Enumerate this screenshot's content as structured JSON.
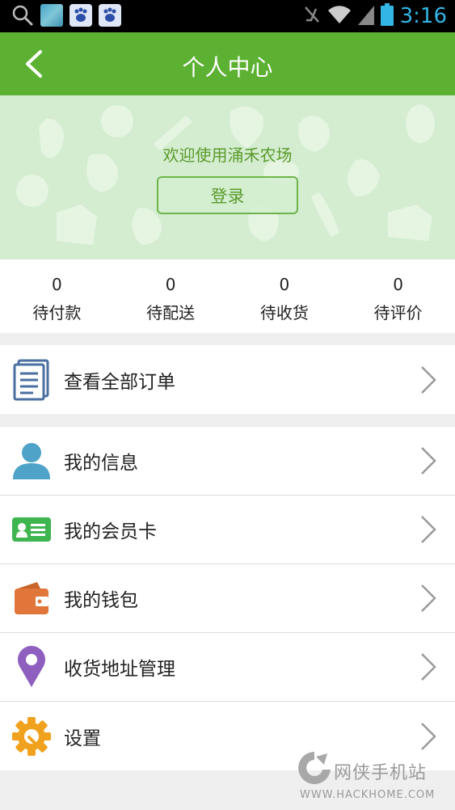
{
  "status_bar": {
    "time": "3:16"
  },
  "header": {
    "title": "个人中心"
  },
  "banner": {
    "welcome": "欢迎使用涌禾农场",
    "login_label": "登录"
  },
  "order_stats": [
    {
      "count": "0",
      "label": "待付款"
    },
    {
      "count": "0",
      "label": "待配送"
    },
    {
      "count": "0",
      "label": "待收货"
    },
    {
      "count": "0",
      "label": "待评价"
    }
  ],
  "menu": {
    "orders": {
      "label": "查看全部订单",
      "icon": "document-icon"
    },
    "items": [
      {
        "label": "我的信息",
        "icon": "user-icon"
      },
      {
        "label": "我的会员卡",
        "icon": "member-card-icon"
      },
      {
        "label": "我的钱包",
        "icon": "wallet-icon"
      },
      {
        "label": "收货地址管理",
        "icon": "location-pin-icon"
      },
      {
        "label": "设置",
        "icon": "gear-icon"
      }
    ]
  },
  "watermark": {
    "title": "网侠手机站",
    "url": "WWW.HACKHOME.COM"
  },
  "colors": {
    "primary_green": "#5cb133",
    "banner_bg": "#d4edd0",
    "status_blue": "#33b5e5"
  }
}
